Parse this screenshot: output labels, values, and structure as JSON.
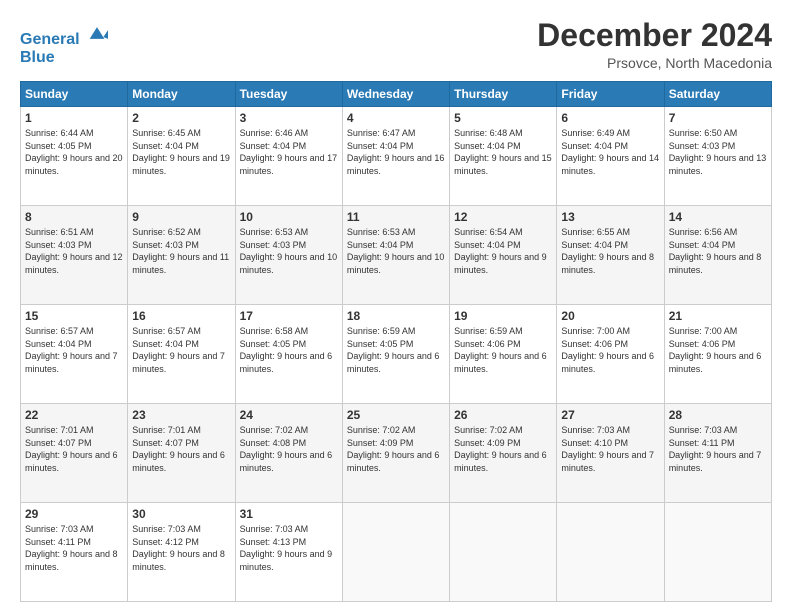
{
  "logo": {
    "line1": "General",
    "line2": "Blue"
  },
  "title": "December 2024",
  "subtitle": "Prsovce, North Macedonia",
  "days_header": [
    "Sunday",
    "Monday",
    "Tuesday",
    "Wednesday",
    "Thursday",
    "Friday",
    "Saturday"
  ],
  "weeks": [
    [
      {
        "day": "1",
        "sunrise": "6:44 AM",
        "sunset": "4:05 PM",
        "daylight": "9 hours and 20 minutes."
      },
      {
        "day": "2",
        "sunrise": "6:45 AM",
        "sunset": "4:04 PM",
        "daylight": "9 hours and 19 minutes."
      },
      {
        "day": "3",
        "sunrise": "6:46 AM",
        "sunset": "4:04 PM",
        "daylight": "9 hours and 17 minutes."
      },
      {
        "day": "4",
        "sunrise": "6:47 AM",
        "sunset": "4:04 PM",
        "daylight": "9 hours and 16 minutes."
      },
      {
        "day": "5",
        "sunrise": "6:48 AM",
        "sunset": "4:04 PM",
        "daylight": "9 hours and 15 minutes."
      },
      {
        "day": "6",
        "sunrise": "6:49 AM",
        "sunset": "4:04 PM",
        "daylight": "9 hours and 14 minutes."
      },
      {
        "day": "7",
        "sunrise": "6:50 AM",
        "sunset": "4:03 PM",
        "daylight": "9 hours and 13 minutes."
      }
    ],
    [
      {
        "day": "8",
        "sunrise": "6:51 AM",
        "sunset": "4:03 PM",
        "daylight": "9 hours and 12 minutes."
      },
      {
        "day": "9",
        "sunrise": "6:52 AM",
        "sunset": "4:03 PM",
        "daylight": "9 hours and 11 minutes."
      },
      {
        "day": "10",
        "sunrise": "6:53 AM",
        "sunset": "4:03 PM",
        "daylight": "9 hours and 10 minutes."
      },
      {
        "day": "11",
        "sunrise": "6:53 AM",
        "sunset": "4:04 PM",
        "daylight": "9 hours and 10 minutes."
      },
      {
        "day": "12",
        "sunrise": "6:54 AM",
        "sunset": "4:04 PM",
        "daylight": "9 hours and 9 minutes."
      },
      {
        "day": "13",
        "sunrise": "6:55 AM",
        "sunset": "4:04 PM",
        "daylight": "9 hours and 8 minutes."
      },
      {
        "day": "14",
        "sunrise": "6:56 AM",
        "sunset": "4:04 PM",
        "daylight": "9 hours and 8 minutes."
      }
    ],
    [
      {
        "day": "15",
        "sunrise": "6:57 AM",
        "sunset": "4:04 PM",
        "daylight": "9 hours and 7 minutes."
      },
      {
        "day": "16",
        "sunrise": "6:57 AM",
        "sunset": "4:04 PM",
        "daylight": "9 hours and 7 minutes."
      },
      {
        "day": "17",
        "sunrise": "6:58 AM",
        "sunset": "4:05 PM",
        "daylight": "9 hours and 6 minutes."
      },
      {
        "day": "18",
        "sunrise": "6:59 AM",
        "sunset": "4:05 PM",
        "daylight": "9 hours and 6 minutes."
      },
      {
        "day": "19",
        "sunrise": "6:59 AM",
        "sunset": "4:06 PM",
        "daylight": "9 hours and 6 minutes."
      },
      {
        "day": "20",
        "sunrise": "7:00 AM",
        "sunset": "4:06 PM",
        "daylight": "9 hours and 6 minutes."
      },
      {
        "day": "21",
        "sunrise": "7:00 AM",
        "sunset": "4:06 PM",
        "daylight": "9 hours and 6 minutes."
      }
    ],
    [
      {
        "day": "22",
        "sunrise": "7:01 AM",
        "sunset": "4:07 PM",
        "daylight": "9 hours and 6 minutes."
      },
      {
        "day": "23",
        "sunrise": "7:01 AM",
        "sunset": "4:07 PM",
        "daylight": "9 hours and 6 minutes."
      },
      {
        "day": "24",
        "sunrise": "7:02 AM",
        "sunset": "4:08 PM",
        "daylight": "9 hours and 6 minutes."
      },
      {
        "day": "25",
        "sunrise": "7:02 AM",
        "sunset": "4:09 PM",
        "daylight": "9 hours and 6 minutes."
      },
      {
        "day": "26",
        "sunrise": "7:02 AM",
        "sunset": "4:09 PM",
        "daylight": "9 hours and 6 minutes."
      },
      {
        "day": "27",
        "sunrise": "7:03 AM",
        "sunset": "4:10 PM",
        "daylight": "9 hours and 7 minutes."
      },
      {
        "day": "28",
        "sunrise": "7:03 AM",
        "sunset": "4:11 PM",
        "daylight": "9 hours and 7 minutes."
      }
    ],
    [
      {
        "day": "29",
        "sunrise": "7:03 AM",
        "sunset": "4:11 PM",
        "daylight": "9 hours and 8 minutes."
      },
      {
        "day": "30",
        "sunrise": "7:03 AM",
        "sunset": "4:12 PM",
        "daylight": "9 hours and 8 minutes."
      },
      {
        "day": "31",
        "sunrise": "7:03 AM",
        "sunset": "4:13 PM",
        "daylight": "9 hours and 9 minutes."
      },
      null,
      null,
      null,
      null
    ]
  ]
}
